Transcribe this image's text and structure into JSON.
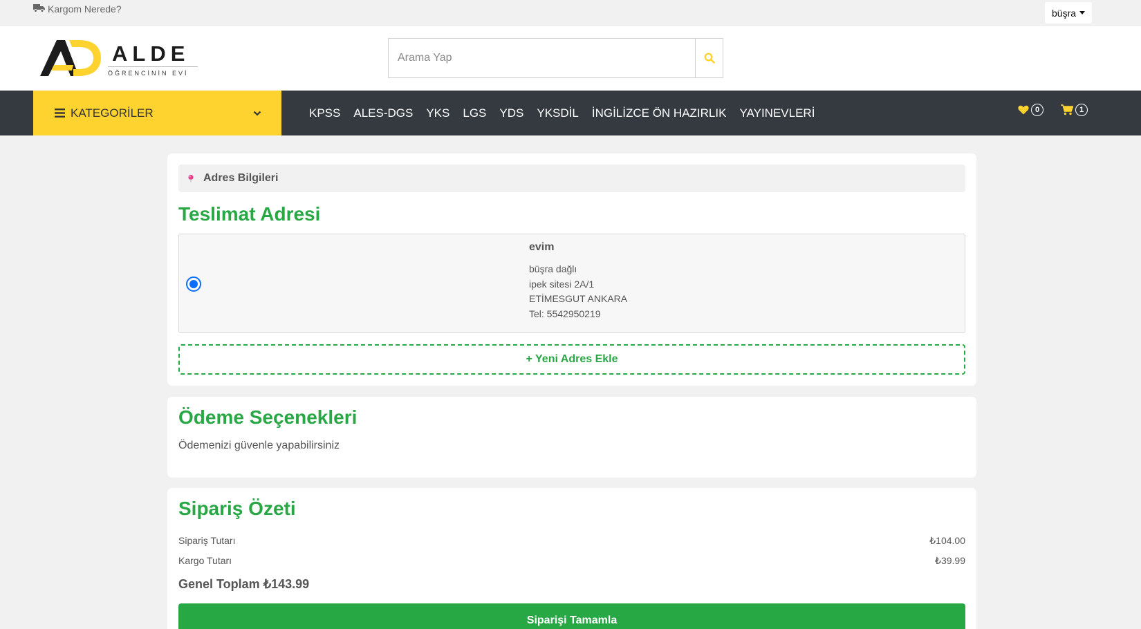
{
  "topbar": {
    "track_label": "Kargom Nerede?",
    "user_name": "büşra"
  },
  "header": {
    "logo_text": "ALDE",
    "logo_sub": "ÖĞRENCİNİN EVİ",
    "search_placeholder": "Arama Yap"
  },
  "nav": {
    "categories_label": "KATEGORİLER",
    "links": [
      "KPSS",
      "ALES-DGS",
      "YKS",
      "LGS",
      "YDS",
      "YKSDİL",
      "İNGİLİZCE ÖN HAZIRLIK",
      "YAYINEVLERİ"
    ],
    "wishlist_count": "0",
    "cart_count": "1"
  },
  "address_section": {
    "info_title": "Adres Bilgileri",
    "title": "Teslimat Adresi",
    "address": {
      "name": "evim",
      "person": "büşra dağlı",
      "line1": "ipek sitesi 2A/1",
      "city": "ETİMESGUT ANKARA",
      "phone": "Tel: 5542950219",
      "selected": true
    },
    "add_new_label": "+ Yeni Adres Ekle"
  },
  "payment_section": {
    "title": "Ödeme Seçenekleri",
    "description": "Ödemenizi güvenle yapabilirsiniz"
  },
  "summary_section": {
    "title": "Sipariş Özeti",
    "order_total_label": "Sipariş Tutarı",
    "order_total_value": "₺104.00",
    "shipping_label": "Kargo Tutarı",
    "shipping_value": "₺39.99",
    "grand_total_label": "Genel Toplam",
    "grand_total_value": "₺143.99",
    "complete_button": "Siparişi Tamamla"
  },
  "colors": {
    "accent_yellow": "#fed330",
    "nav_dark": "#343a40",
    "success_green": "#28a745",
    "radio_blue": "#0d6efd",
    "pin_pink": "#e83e8c"
  },
  "icons": {
    "track": "truck-icon",
    "search": "search-icon",
    "menu": "bars-icon",
    "dropdown": "chevron-down-icon",
    "wishlist": "heart-icon",
    "cart": "cart-icon",
    "info": "map-pin-icon"
  }
}
